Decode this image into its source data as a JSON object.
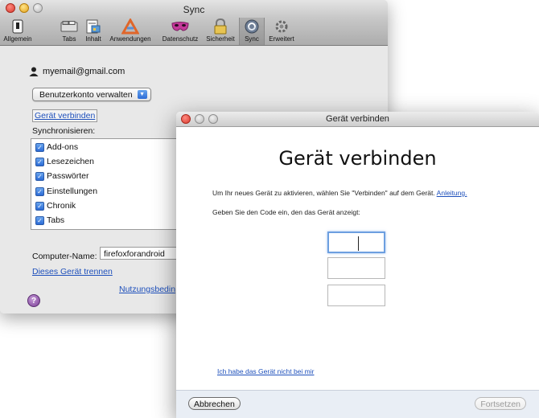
{
  "prefs_window": {
    "title": "Sync",
    "toolbar": [
      {
        "label": "Allgemein",
        "icon": "switch-icon"
      },
      {
        "label": "Tabs",
        "icon": "tabs-icon"
      },
      {
        "label": "Inhalt",
        "icon": "content-icon"
      },
      {
        "label": "Anwendungen",
        "icon": "applications-icon"
      },
      {
        "label": "Datenschutz",
        "icon": "mask-icon"
      },
      {
        "label": "Sicherheit",
        "icon": "lock-icon"
      },
      {
        "label": "Sync",
        "icon": "sync-icon"
      },
      {
        "label": "Erweitert",
        "icon": "gear-icon"
      }
    ],
    "selected_tab": "Sync",
    "account_email": "myemail@gmail.com",
    "manage_account": "Benutzerkonto verwalten",
    "connect_device_link": "Gerät verbinden",
    "sync_label": "Synchronisieren:",
    "sync_items": [
      {
        "label": "Add-ons",
        "checked": true
      },
      {
        "label": "Lesezeichen",
        "checked": true
      },
      {
        "label": "Passwörter",
        "checked": true
      },
      {
        "label": "Einstellungen",
        "checked": true
      },
      {
        "label": "Chronik",
        "checked": true
      },
      {
        "label": "Tabs",
        "checked": true
      }
    ],
    "computer_name_label": "Computer-Name:",
    "computer_name_value": "firefoxforandroid",
    "disconnect_link": "Dieses Gerät trennen",
    "terms_link": "Nutzungsbedin",
    "help": "?"
  },
  "dialog": {
    "title": "Gerät verbinden",
    "heading": "Gerät verbinden",
    "instruction_text": "Um Ihr neues Gerät zu aktivieren, wählen Sie \"Verbinden\" auf dem Gerät.",
    "instruction_link": "Anleitung.",
    "code_prompt": "Geben Sie den Code ein, den das Gerät anzeigt:",
    "code_fields": [
      "",
      "",
      ""
    ],
    "no_device_link": "Ich habe das Gerät nicht bei mir",
    "cancel_button": "Abbrechen",
    "continue_button": "Fortsetzen"
  }
}
